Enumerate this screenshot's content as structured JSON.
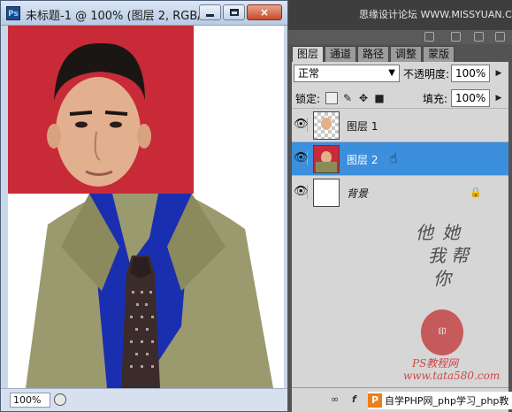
{
  "document": {
    "app_icon": "Ps",
    "title": "未标题-1 @ 100% (图层 2, RGB/8...",
    "zoom": "100%",
    "buttons": {
      "minimize": "minimize-icon",
      "maximize": "maximize-icon",
      "close": "×"
    }
  },
  "panel": {
    "watermark_top": "思缘设计论坛 WWW.MISSYUAN.COM",
    "tabs": [
      {
        "label": "图层",
        "active": true
      },
      {
        "label": "通道",
        "active": false
      },
      {
        "label": "路径",
        "active": false
      },
      {
        "label": "调整",
        "active": false
      },
      {
        "label": "蒙版",
        "active": false
      }
    ],
    "blend_mode": "正常",
    "opacity_label": "不透明度:",
    "opacity_value": "100%",
    "lock_label": "锁定:",
    "fill_label": "填充:",
    "fill_value": "100%",
    "layers": [
      {
        "name": "图层 1",
        "selected": false,
        "thumb": "transparent"
      },
      {
        "name": "图层 2",
        "selected": true,
        "thumb": "photo"
      },
      {
        "name": "背景",
        "selected": false,
        "thumb": "white",
        "locked": true
      }
    ],
    "watermark_lines": [
      "他",
      "她",
      "我",
      "帮",
      "你"
    ],
    "seal_text": "印",
    "watermark_bottom_1": "PS教程网",
    "watermark_bottom_2": "www.tata580.com",
    "site_logo": "P",
    "site_text": "自学PHP网_php学习_php教"
  },
  "colors": {
    "selected_layer": "#3b8fdc",
    "photo_background": "#c82a38",
    "panel_dark": "#535353"
  }
}
